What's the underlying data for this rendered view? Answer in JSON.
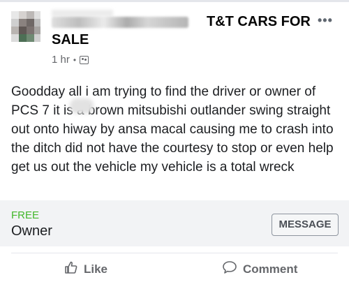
{
  "post": {
    "group_name_line1": "T&T CARS FOR",
    "group_name_line2": "SALE",
    "time": "1 hr",
    "meta_separator": "•",
    "more_label": "•••",
    "text": "Goodday all i am trying to find the driver or owner of PCS 7 it is a brown mitsubishi outlander swing straight out onto hiway by ansa macal causing me to crash into the ditch did not have the courtesy to stop  or even help get us out the vehicle my vehicle is a total wreck"
  },
  "sale": {
    "price": "FREE",
    "title": "Owner",
    "message_button": "MESSAGE"
  },
  "actions": {
    "like_label": "Like",
    "comment_label": "Comment"
  },
  "colors": {
    "price": "#42b72a",
    "muted": "#65676b",
    "sale_bg": "#f2f3f5"
  },
  "icons": {
    "more": "more-dots-icon",
    "audience": "group-audience-icon",
    "like": "thumbs-up-icon",
    "comment": "comment-bubble-icon"
  }
}
